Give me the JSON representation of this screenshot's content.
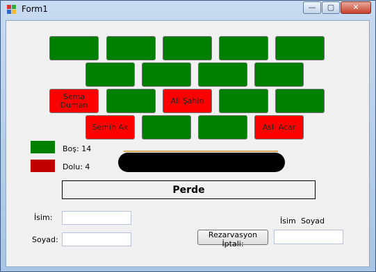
{
  "window": {
    "title": "Form1"
  },
  "titlebar": {
    "minimize_glyph": "—",
    "maximize_glyph": "▢",
    "close_glyph": "✕"
  },
  "colors": {
    "empty": "#008000",
    "full": "#ff0000",
    "legend_full": "#c00000"
  },
  "seats": [
    {
      "status": "empty",
      "label": ""
    },
    {
      "status": "empty",
      "label": ""
    },
    {
      "status": "empty",
      "label": ""
    },
    {
      "status": "empty",
      "label": ""
    },
    {
      "status": "empty",
      "label": ""
    },
    {
      "status": "empty",
      "label": ""
    },
    {
      "status": "empty",
      "label": ""
    },
    {
      "status": "empty",
      "label": ""
    },
    {
      "status": "empty",
      "label": ""
    },
    {
      "status": "full",
      "label": "Sema Duman"
    },
    {
      "status": "empty",
      "label": ""
    },
    {
      "status": "full",
      "label": "Ali Şahin"
    },
    {
      "status": "empty",
      "label": ""
    },
    {
      "status": "empty",
      "label": ""
    },
    {
      "status": "full",
      "label": "Semih Ak"
    },
    {
      "status": "empty",
      "label": ""
    },
    {
      "status": "empty",
      "label": ""
    },
    {
      "status": "full",
      "label": "Aslı Acar"
    }
  ],
  "legend": {
    "empty_label": "Boş: 14",
    "full_label": "Dolu: 4"
  },
  "stage": {
    "label": "Perde"
  },
  "form": {
    "name_label": "İsim:",
    "surname_label": "Soyad:",
    "name_value": "",
    "surname_value": ""
  },
  "cancel": {
    "button_label": "Rezarvasyon İptali:",
    "header_name": "İsim",
    "header_surname": "Soyad",
    "value": ""
  }
}
